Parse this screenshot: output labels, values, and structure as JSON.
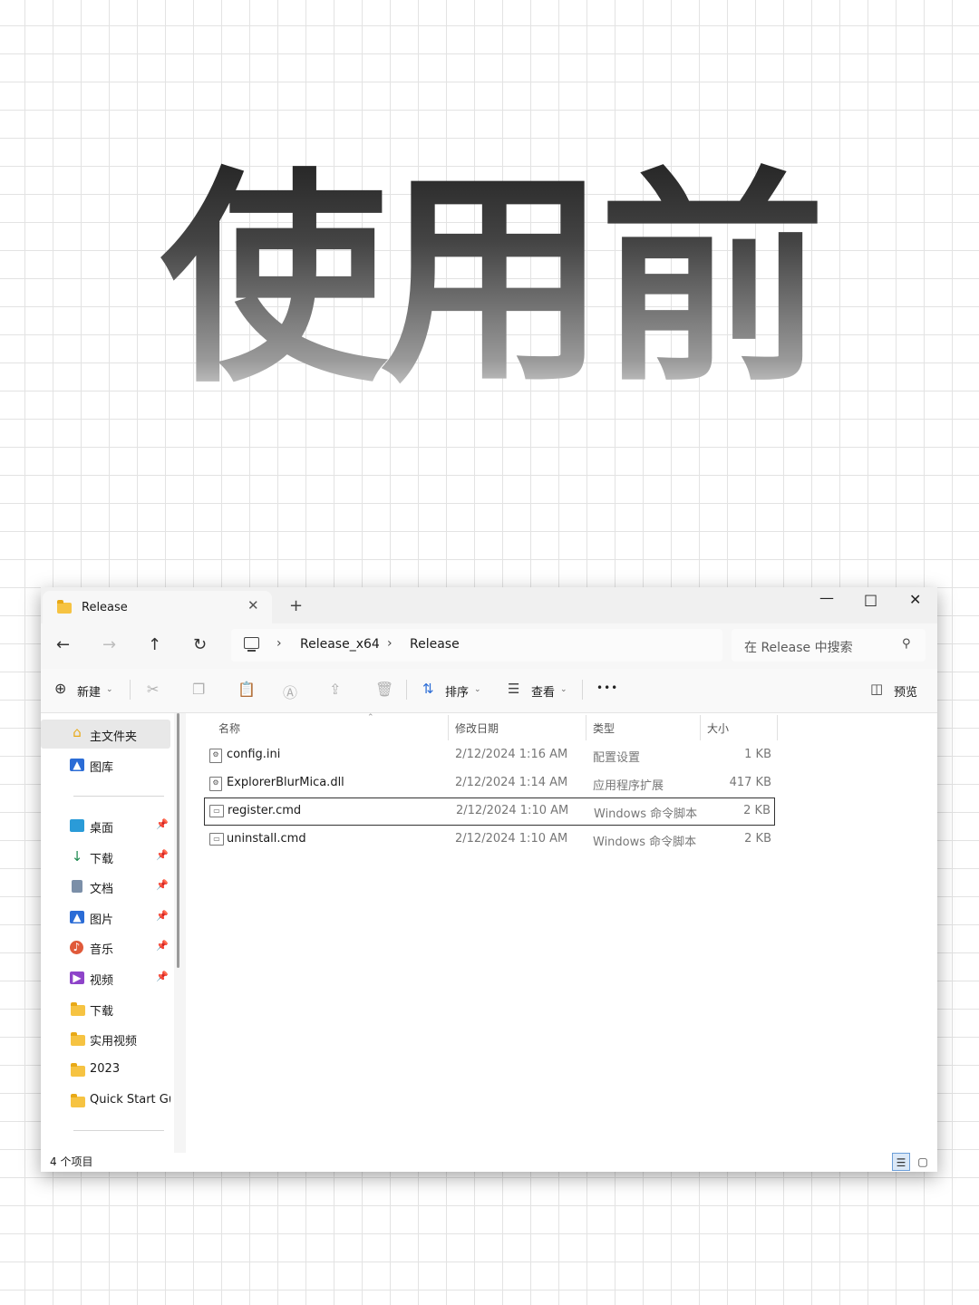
{
  "headline": "使用前",
  "window": {
    "tab": {
      "label": "Release"
    },
    "controls": {
      "minimize": "—",
      "maximize": "□",
      "close": "✕"
    },
    "address": {
      "crumbs": [
        "Release_x64",
        "Release"
      ],
      "separator": "›"
    },
    "search": {
      "placeholder": "在 Release 中搜索"
    },
    "toolbar": {
      "new_label": "新建",
      "sort_label": "排序",
      "view_label": "查看",
      "more_label": "•••",
      "preview_label": "预览"
    },
    "sidebar": {
      "items": [
        {
          "label": "主文件夹",
          "icon": "home-icon",
          "pinned": false
        },
        {
          "label": "图库",
          "icon": "gallery-icon",
          "pinned": false
        },
        {
          "label": "桌面",
          "icon": "desktop-icon",
          "pinned": true
        },
        {
          "label": "下载",
          "icon": "download-icon",
          "pinned": true
        },
        {
          "label": "文档",
          "icon": "document-icon",
          "pinned": true
        },
        {
          "label": "图片",
          "icon": "pictures-icon",
          "pinned": true
        },
        {
          "label": "音乐",
          "icon": "music-icon",
          "pinned": true
        },
        {
          "label": "视频",
          "icon": "video-icon",
          "pinned": true
        },
        {
          "label": "下载",
          "icon": "folder-icon",
          "pinned": false
        },
        {
          "label": "实用视频",
          "icon": "folder-icon",
          "pinned": false
        },
        {
          "label": "2023",
          "icon": "folder-icon",
          "pinned": false
        },
        {
          "label": "Quick Start Gui",
          "icon": "folder-icon",
          "pinned": false
        }
      ]
    },
    "columns": {
      "name": "名称",
      "date": "修改日期",
      "type": "类型",
      "size": "大小"
    },
    "files": [
      {
        "name": "config.ini",
        "date": "2/12/2024 1:16 AM",
        "type": "配置设置",
        "size": "1 KB"
      },
      {
        "name": "ExplorerBlurMica.dll",
        "date": "2/12/2024 1:14 AM",
        "type": "应用程序扩展",
        "size": "417 KB"
      },
      {
        "name": "register.cmd",
        "date": "2/12/2024 1:10 AM",
        "type": "Windows 命令脚本",
        "size": "2 KB"
      },
      {
        "name": "uninstall.cmd",
        "date": "2/12/2024 1:10 AM",
        "type": "Windows 命令脚本",
        "size": "2 KB"
      }
    ],
    "status": {
      "count": "4 个项目"
    },
    "colors": {
      "accent": "#2b6cd6",
      "folder": "#f6c342"
    }
  }
}
